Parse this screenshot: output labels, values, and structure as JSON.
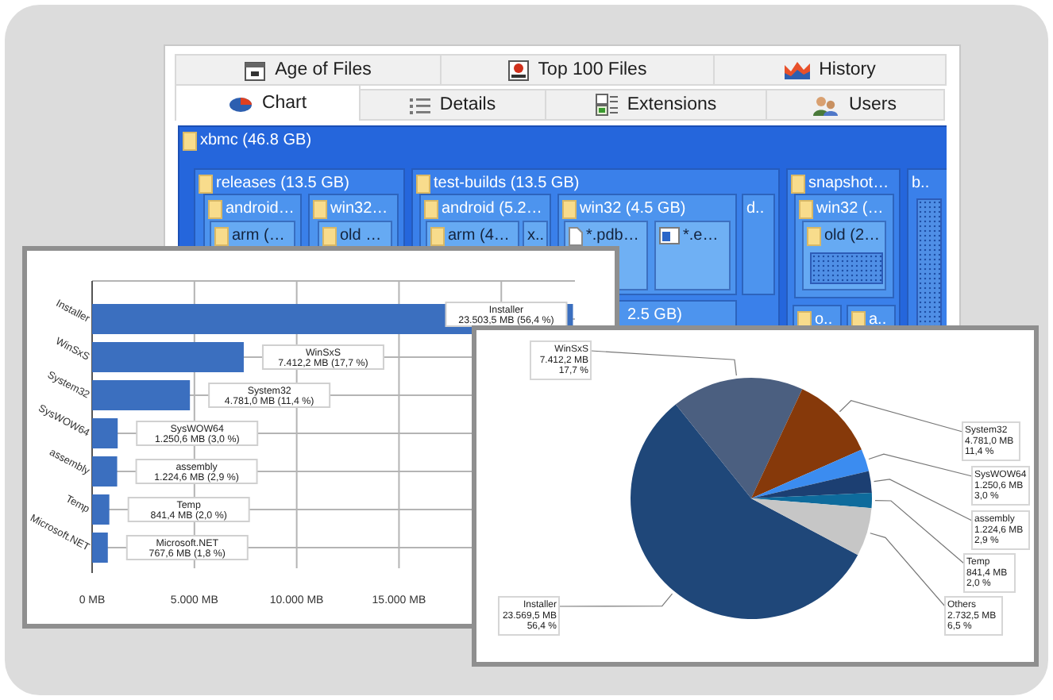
{
  "main_window": {
    "tab_rows": [
      [
        {
          "label": "Age of Files",
          "selected": false
        },
        {
          "label": "Top 100 Files",
          "selected": false
        },
        {
          "label": "History",
          "selected": false
        }
      ],
      [
        {
          "label": "Chart",
          "selected": true
        },
        {
          "label": "Details",
          "selected": false
        },
        {
          "label": "Extensions",
          "selected": false
        },
        {
          "label": "Users",
          "selected": false
        }
      ]
    ],
    "treemap": {
      "label": "xbmc (46.8 GB)",
      "kind": "folder",
      "children": [
        {
          "label": "releases (13.5 GB)",
          "kind": "folder",
          "children": [
            {
              "label": "android…",
              "kind": "folder",
              "children": [
                {
                  "label": "arm (…",
                  "kind": "folder"
                }
              ]
            },
            {
              "label": "win32…",
              "kind": "folder",
              "children": [
                {
                  "label": "old …",
                  "kind": "folder"
                }
              ]
            }
          ]
        },
        {
          "label": "test-builds (13.5 GB)",
          "kind": "folder",
          "children": [
            {
              "label": "android (5.2…",
              "kind": "folder",
              "children": [
                {
                  "label": "arm (4…",
                  "kind": "folder"
                },
                {
                  "label": "x..",
                  "kind": "plain"
                }
              ]
            },
            {
              "label": "win32 (4.5 GB)",
              "kind": "folder",
              "children": [
                {
                  "label": "*.pdb…",
                  "kind": "document"
                },
                {
                  "label": "*.e…",
                  "kind": "program"
                }
              ]
            },
            {
              "label": "d..",
              "kind": "plain"
            },
            {
              "label": "2.5 GB)",
              "kind": "plain"
            }
          ]
        },
        {
          "label": "snapshot…",
          "kind": "folder",
          "children": [
            {
              "label": "win32 (…",
              "kind": "folder",
              "children": [
                {
                  "label": "old (2…",
                  "kind": "folder"
                }
              ]
            },
            {
              "label": "o..",
              "kind": "folder"
            },
            {
              "label": "a..",
              "kind": "folder"
            }
          ]
        },
        {
          "label": "b..",
          "kind": "plain"
        }
      ]
    }
  },
  "bar_chart_window": {
    "chart_data": {
      "type": "bar",
      "orientation": "horizontal",
      "categories": [
        "Installer",
        "WinSxS",
        "System32",
        "SysWOW64",
        "assembly",
        "Temp",
        "Microsoft.NET"
      ],
      "series": [
        {
          "color": "#3b6fbf",
          "values": [
            23503.5,
            7412.2,
            4781.0,
            1250.6,
            1224.6,
            841.4,
            767.6
          ]
        }
      ],
      "xlim": [
        0,
        23600
      ],
      "grid": true,
      "xticks": [
        {
          "value": 0,
          "label": "0 MB"
        },
        {
          "value": 5000,
          "label": "5.000 MB"
        },
        {
          "value": 10000,
          "label": "10.000 MB"
        },
        {
          "value": 15000,
          "label": "15.000 MB"
        }
      ],
      "value_labels": [
        "Installer\n23.503,5 MB (56,4 %)",
        "WinSxS\n7.412,2 MB (17,7 %)",
        "System32\n4.781,0 MB (11,4 %)",
        "SysWOW64\n1.250,6 MB (3,0 %)",
        "assembly\n1.224,6 MB (2,9 %)",
        "Temp\n841,4 MB (2,0 %)",
        "Microsoft.NET\n767,6 MB (1,8 %)"
      ]
    }
  },
  "pie_chart_window": {
    "chart_data": {
      "type": "pie",
      "categories": [
        "Installer",
        "WinSxS",
        "System32",
        "SysWOW64",
        "assembly",
        "Temp",
        "Others"
      ],
      "series": [
        {
          "values": [
            56.4,
            17.7,
            11.4,
            3.0,
            2.9,
            2.0,
            6.5
          ]
        }
      ],
      "colors": [
        "#1f4779",
        "#4b5f80",
        "#86390a",
        "#3b8cf0",
        "#1c3f72",
        "#0e6b9c",
        "#c6c6c6"
      ],
      "value_labels": [
        "23.569,5 MB\n56,4 %",
        "7.412,2 MB\n17,7 %",
        "4.781,0 MB\n11,4 %",
        "1.250,6 MB\n3,0 %",
        "1.224,6 MB\n2,9 %",
        "841,4 MB\n2,0 %",
        "2.732,5 MB\n6,5 %"
      ]
    }
  }
}
